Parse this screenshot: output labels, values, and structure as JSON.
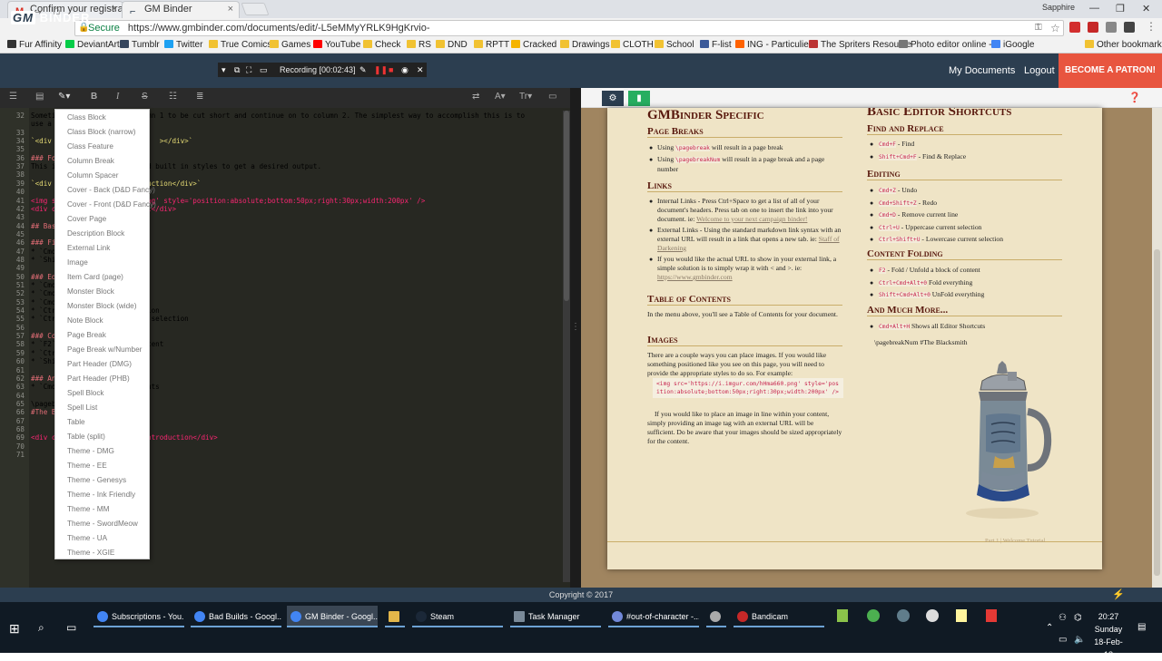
{
  "browser": {
    "tabs": [
      {
        "title": "Confirm your registratio",
        "icon": "gmail-icon",
        "active": false
      },
      {
        "title": "GM Binder",
        "icon": "gmbinder-icon",
        "active": true
      }
    ],
    "user": "Sapphire",
    "secure_label": "Secure",
    "url": "https://www.gmbinder.com/documents/edit/-L5eMMyYRLK9HgKrvio-",
    "bookmarks": [
      "Fur Affinity",
      "DeviantArt",
      "Tumblr",
      "Twitter",
      "True Comics",
      "Games",
      "YouTube",
      "Check",
      "RS",
      "DND",
      "RPTT",
      "Cracked",
      "Drawings",
      "CLOTH",
      "School",
      "F-list",
      "ING - Particulier",
      "The Spriters Resource",
      "Photo editor online -",
      "iGoogle"
    ],
    "other_bookmarks": "Other bookmarks"
  },
  "header": {
    "logo_text": "BINDER",
    "logo_gm": "GM",
    "recording": "Recording [00:02:43]",
    "nav": {
      "my_documents": "My Documents",
      "logout": "Logout",
      "patron": "BECOME A PATRON!"
    }
  },
  "editor": {
    "lines": [
      {
        "n": "32",
        "text": "Someti             t in column 1 to be cut short and continue on to column 2. The simplest way to accomplish this is to"
      },
      {
        "n": "",
        "text": "use a"
      },
      {
        "n": "33",
        "text": ""
      },
      {
        "n": "34",
        "text": "`<div                          ></div>`"
      },
      {
        "n": "35",
        "text": ""
      },
      {
        "n": "36",
        "text": "### Fo"
      },
      {
        "n": "37",
        "text": "This i                 ml and built in styles to get a desired output."
      },
      {
        "n": "38",
        "text": ""
      },
      {
        "n": "39",
        "text": "`<div                 Introduction</div>`"
      },
      {
        "n": "40",
        "text": ""
      },
      {
        "n": "41",
        "text": "<img s              hma660.png' style='position:absolute;bottom:50px;right:30px;width:200px' />"
      },
      {
        "n": "42",
        "text": "<div c               Tutorial</div>"
      },
      {
        "n": "43",
        "text": ""
      },
      {
        "n": "44",
        "text": "## Bas"
      },
      {
        "n": "45",
        "text": ""
      },
      {
        "n": "46",
        "text": "### Fi"
      },
      {
        "n": "47",
        "text": "* `Cmd"
      },
      {
        "n": "48",
        "text": "* `Shi                 ce"
      },
      {
        "n": "49",
        "text": ""
      },
      {
        "n": "50",
        "text": "### Ed"
      },
      {
        "n": "51",
        "text": "* `Cmd"
      },
      {
        "n": "52",
        "text": "* `Cmd"
      },
      {
        "n": "53",
        "text": "* `Cmd               e"
      },
      {
        "n": "54",
        "text": "* `Ctr                selection"
      },
      {
        "n": "55",
        "text": "* `Ctr                urrent selection"
      },
      {
        "n": "56",
        "text": ""
      },
      {
        "n": "57",
        "text": "### Co"
      },
      {
        "n": "58",
        "text": "* `F2`                of content"
      },
      {
        "n": "59",
        "text": "* `Ctr               hing"
      },
      {
        "n": "60",
        "text": "* `Shi               rything"
      },
      {
        "n": "61",
        "text": ""
      },
      {
        "n": "62",
        "text": "### An"
      },
      {
        "n": "63",
        "text": "* `Cmd                Shortcuts"
      },
      {
        "n": "64",
        "text": ""
      },
      {
        "n": "65",
        "text": "\\pageb"
      },
      {
        "n": "66",
        "text": "#The B"
      },
      {
        "n": "67",
        "text": ""
      },
      {
        "n": "68",
        "text": ""
      },
      {
        "n": "69",
        "text": "<div c                Your Introduction</div>"
      },
      {
        "n": "70",
        "text": ""
      },
      {
        "n": "71",
        "text": ""
      }
    ],
    "snippet_menu": [
      "Class Block",
      "Class Block (narrow)",
      "Class Feature",
      "Column Break",
      "Column Spacer",
      "Cover - Back (D&D Fancy)",
      "Cover - Front (D&D Fancy)",
      "Cover Page",
      "Description Block",
      "External Link",
      "Image",
      "Item Card (page)",
      "Monster Block",
      "Monster Block (wide)",
      "Note Block",
      "Page Break",
      "Page Break w/Number",
      "Part Header (DMG)",
      "Part Header (PHB)",
      "Spell Block",
      "Spell List",
      "Table",
      "Table (split)",
      "Theme - DMG",
      "Theme - EE",
      "Theme - Genesys",
      "Theme - Ink Friendly",
      "Theme - MM",
      "Theme - SwordMeow",
      "Theme - UA",
      "Theme - XGIE"
    ]
  },
  "preview": {
    "left": {
      "title": "GMBinder Specific",
      "page_breaks": {
        "heading": "Page Breaks",
        "items": [
          {
            "pre": "Using ",
            "code": "\\pagebreak",
            "post": " will result in a page break"
          },
          {
            "pre": "Using ",
            "code": "\\pagebreakNum",
            "post": " will result in a page break and a page number"
          }
        ]
      },
      "links": {
        "heading": "Links",
        "items": [
          {
            "text": "Internal Links - Press Ctrl+Space to get a list of all of your document's headers. Press tab on one to insert the link into your document. ie: ",
            "link": "Welcome to your next campaign binder!"
          },
          {
            "text": "External Links - Using the standard markdown link syntax with an external URL will result in a link that opens a new tab. ie: ",
            "link": "Staff of Darkening"
          },
          {
            "text": "If you would like the actual URL to show in your external link, a simple solution is to simply wrap it with < and >. ie: ",
            "link": "https://www.gmbinder.com"
          }
        ]
      },
      "toc": {
        "heading": "Table of Contents",
        "text": "In the menu above, you'll see a Table of Contents for your document."
      },
      "images": {
        "heading": "Images",
        "text1": "There are a couple ways you can place images. If you would like something positioned like you see on this page, you will need to provide the appropriate styles to do so. For example:",
        "code": "<img src='https://i.imgur.com/hHma660.png' style='position:absolute;bottom:50px;right:30px;width:200px' />",
        "text2": "If you would like to place an image in line within your content, simply providing an image tag with an external URL will be sufficient. Do be aware that your images should be sized appropriately for the content."
      }
    },
    "right": {
      "title": "Basic Editor Shortcuts",
      "find_replace": {
        "heading": "Find and Replace",
        "items": [
          {
            "key": "Cmd+F",
            "desc": " - Find"
          },
          {
            "key": "Shift+Cmd+F",
            "desc": " - Find & Replace"
          }
        ]
      },
      "editing": {
        "heading": "Editing",
        "items": [
          {
            "key": "Cmd+Z",
            "desc": " - Undo"
          },
          {
            "key": "Cmd+Shift+Z",
            "desc": " - Redo"
          },
          {
            "key": "Cmd+D",
            "desc": " - Remove current line"
          },
          {
            "key": "Ctrl+U",
            "desc": " - Uppercase current selection"
          },
          {
            "key": "Ctrl+Shift+U",
            "desc": " - Lowercase current selection"
          }
        ]
      },
      "folding": {
        "heading": "Content Folding",
        "items": [
          {
            "key": "F2",
            "desc": " - Fold / Unfold a block of content"
          },
          {
            "key": "Ctrl+Cmd+Alt+0",
            "desc": " Fold everything"
          },
          {
            "key": "Shift+Cmd+Alt+0",
            "desc": " UnFold everything"
          }
        ]
      },
      "more": {
        "heading": "And Much More...",
        "items": [
          {
            "key": "Cmd+Alt+H",
            "desc": " Shows all Editor Shortcuts"
          }
        ]
      },
      "raw": "\\pagebreakNum #The Blacksmith"
    },
    "footnote": "Part 1 | Welcome Tutorial"
  },
  "footer": {
    "copyright": "Copyright © 2017"
  },
  "taskbar": {
    "tasks": [
      "Subscriptions - You...",
      "Bad Builds - Googl...",
      "GM Binder - Googl...",
      "",
      "Steam",
      "Task Manager",
      "#out-of-character -...",
      "",
      "Bandicam"
    ],
    "time": "20:27",
    "day": "Sunday",
    "date": "18-Feb-18"
  },
  "colors": {
    "accent_header": "#2c3e50",
    "patron": "#e8553f",
    "editor_bg": "#272822",
    "parchment": "#efe4c6",
    "heading_red": "#58180d"
  }
}
